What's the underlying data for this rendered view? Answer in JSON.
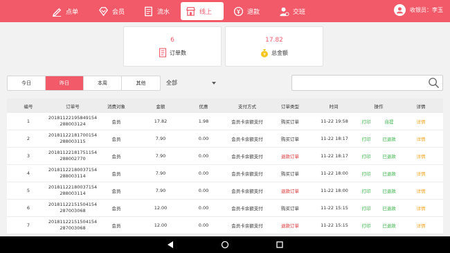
{
  "nav": {
    "items": [
      {
        "label": "点单",
        "icon": "pen-icon"
      },
      {
        "label": "会员",
        "icon": "diamond-icon"
      },
      {
        "label": "流水",
        "icon": "document-icon"
      },
      {
        "label": "线上",
        "icon": "store-icon"
      },
      {
        "label": "退款",
        "icon": "refund-icon"
      },
      {
        "label": "交班",
        "icon": "user-shift-icon"
      }
    ],
    "active_index": 3,
    "cashier": "收银员：李玉"
  },
  "summary": {
    "order_count": "6",
    "order_count_label": "订单数",
    "total_amount": "17.82",
    "total_amount_label": "总金额"
  },
  "filters": {
    "ranges": [
      "今日",
      "昨日",
      "本周",
      "其他"
    ],
    "active_range": 1,
    "type_select": "全部",
    "search_placeholder": ""
  },
  "table": {
    "headers": [
      "编号",
      "订单号",
      "消费对象",
      "金额",
      "优惠",
      "支付方式",
      "订单类型",
      "时间",
      "操作",
      "详情"
    ],
    "rows": [
      {
        "no": "1",
        "order_a": "20181122195849154",
        "order_b": "288003124",
        "target": "会员",
        "amount": "17.82",
        "discount": "1.98",
        "pay": "会员卡余额支付",
        "type": "购买订单",
        "type_refund": false,
        "time": "11-22 19:58",
        "print": "打印",
        "status": "自提",
        "detail": "详情"
      },
      {
        "no": "2",
        "order_a": "20181122181700154",
        "order_b": "288003115",
        "target": "会员",
        "amount": "7.90",
        "discount": "0.00",
        "pay": "会员卡余额支付",
        "type": "购买订单",
        "type_refund": false,
        "time": "11-22 18:17",
        "print": "打印",
        "status": "已退款",
        "detail": "详情"
      },
      {
        "no": "3",
        "order_a": "20181122181751154",
        "order_b": "288002770",
        "target": "会员",
        "amount": "7.90",
        "discount": "0.00",
        "pay": "会员卡余额支付",
        "type": "退款订单",
        "type_refund": true,
        "time": "11-22 18:17",
        "print": "打印",
        "status": "已退款",
        "detail": "详情"
      },
      {
        "no": "4",
        "order_a": "20181122180037154",
        "order_b": "288003114",
        "target": "会员",
        "amount": "7.90",
        "discount": "0.00",
        "pay": "会员卡余额支付",
        "type": "购买订单",
        "type_refund": false,
        "time": "11-22 18:00",
        "print": "打印",
        "status": "已退款",
        "detail": "详情"
      },
      {
        "no": "5",
        "order_a": "20181122180037154",
        "order_b": "288003114",
        "target": "会员",
        "amount": "7.90",
        "discount": "0.00",
        "pay": "会员卡余额支付",
        "type": "退款订单",
        "type_refund": true,
        "time": "11-22 18:00",
        "print": "打印",
        "status": "已退款",
        "detail": "详情"
      },
      {
        "no": "6",
        "order_a": "20181122151504154",
        "order_b": "287003068",
        "target": "会员",
        "amount": "12.00",
        "discount": "0.00",
        "pay": "会员卡余额支付",
        "type": "购买订单",
        "type_refund": false,
        "time": "11-22 15:15",
        "print": "打印",
        "status": "已退款",
        "detail": "详情"
      },
      {
        "no": "7",
        "order_a": "20181122151504154",
        "order_b": "287003068",
        "target": "会员",
        "amount": "12.00",
        "discount": "0.00",
        "pay": "会员卡余额支付",
        "type": "退款订单",
        "type_refund": true,
        "time": "11-22 15:15",
        "print": "打印",
        "status": "已退款",
        "detail": "详情"
      }
    ]
  },
  "colors": {
    "accent": "#f25a6a",
    "green": "#3ab54a",
    "refund_red": "#e03030",
    "detail_orange": "#f5a623"
  }
}
